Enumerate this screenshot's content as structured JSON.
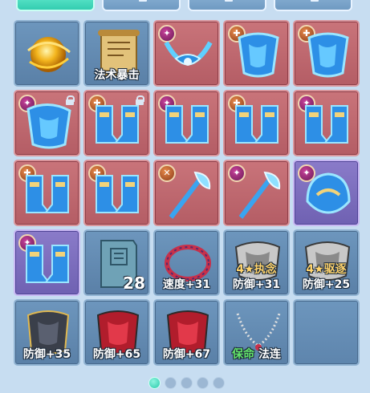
{
  "colors": {
    "normal_slot": "#6d96bd",
    "red_slot": "#c9747a",
    "purple_slot": "#8a7bc9",
    "active_tab": "#33cdb0"
  },
  "tabs": [
    {
      "active": true
    },
    {
      "active": false
    },
    {
      "active": false
    },
    {
      "active": false
    }
  ],
  "slots": [
    {
      "kind": "normal",
      "icon": "golden-orb-icon",
      "caption": ""
    },
    {
      "kind": "normal",
      "icon": "scroll-icon",
      "caption": "法术暴击"
    },
    {
      "kind": "red",
      "icon": "blue-necklace-icon",
      "badge": "purple",
      "caption": ""
    },
    {
      "kind": "red",
      "icon": "blue-armor-icon",
      "badge": "orange",
      "caption": ""
    },
    {
      "kind": "red",
      "icon": "blue-armor-icon",
      "badge": "orange",
      "caption": ""
    },
    {
      "kind": "red",
      "icon": "blue-armor-icon",
      "badge": "purple",
      "locked": true,
      "caption": ""
    },
    {
      "kind": "red",
      "icon": "blue-boots-icon",
      "badge": "orange",
      "locked": true,
      "caption": ""
    },
    {
      "kind": "red",
      "icon": "blue-boots-icon",
      "badge": "purple",
      "caption": ""
    },
    {
      "kind": "red",
      "icon": "blue-boots-icon",
      "badge": "orange",
      "caption": ""
    },
    {
      "kind": "red",
      "icon": "blue-boots-icon",
      "badge": "purple",
      "caption": ""
    },
    {
      "kind": "red",
      "icon": "blue-boots-icon",
      "badge": "orange",
      "caption": ""
    },
    {
      "kind": "red",
      "icon": "blue-boots-icon",
      "badge": "orange",
      "caption": ""
    },
    {
      "kind": "red",
      "icon": "blue-staff-icon",
      "badge": "orange",
      "caption": ""
    },
    {
      "kind": "red",
      "icon": "blue-staff-icon",
      "badge": "purple",
      "caption": ""
    },
    {
      "kind": "purple",
      "icon": "blue-helmet-icon",
      "badge": "purple",
      "caption": ""
    },
    {
      "kind": "purple",
      "icon": "blue-boots-icon",
      "badge": "purple",
      "caption": ""
    },
    {
      "kind": "normal",
      "icon": "book-icon",
      "count": "28",
      "caption": ""
    },
    {
      "kind": "normal",
      "icon": "red-necklace-icon",
      "caption": "速度+31"
    },
    {
      "kind": "normal",
      "icon": "silver-chest-icon",
      "caption": "防御+31",
      "label": "4★执念"
    },
    {
      "kind": "normal",
      "icon": "silver-chest-icon",
      "caption": "防御+25",
      "label": "4★驱逐"
    },
    {
      "kind": "normal",
      "icon": "dark-armor-icon",
      "caption": "防御+35"
    },
    {
      "kind": "normal",
      "icon": "red-armor-icon",
      "caption": "防御+65"
    },
    {
      "kind": "normal",
      "icon": "red-armor-icon",
      "caption": "防御+67"
    },
    {
      "kind": "normal",
      "icon": "bead-necklace-icon",
      "caption_green": "保命",
      "caption": "法连"
    },
    {
      "kind": "empty",
      "icon": "",
      "caption": ""
    }
  ],
  "pager": {
    "pages": 5,
    "current": 1
  }
}
